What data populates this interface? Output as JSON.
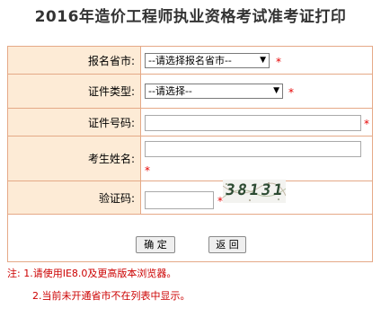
{
  "title": "2016年造价工程师执业资格考试准考证打印",
  "form": {
    "province": {
      "label": "报名省市:",
      "selected": "--请选择报名省市--"
    },
    "cert_type": {
      "label": "证件类型:",
      "selected": "--请选择--"
    },
    "cert_no": {
      "label": "证件号码:",
      "value": ""
    },
    "name": {
      "label": "考生姓名:",
      "value": ""
    },
    "captcha": {
      "label": "验证码:",
      "value": "",
      "image_text": "38131"
    },
    "required_mark": "*"
  },
  "buttons": {
    "confirm": "确 定",
    "back": "返 回"
  },
  "notes": {
    "note1": "注: 1.请使用IE8.0及更高版本浏览器。",
    "note2": "2.当前未开通省市不在列表中显示。"
  },
  "colors": {
    "label_bg": "#fdebd6",
    "border": "#e5a987",
    "required": "#e60000",
    "note_text": "#cc0000"
  }
}
